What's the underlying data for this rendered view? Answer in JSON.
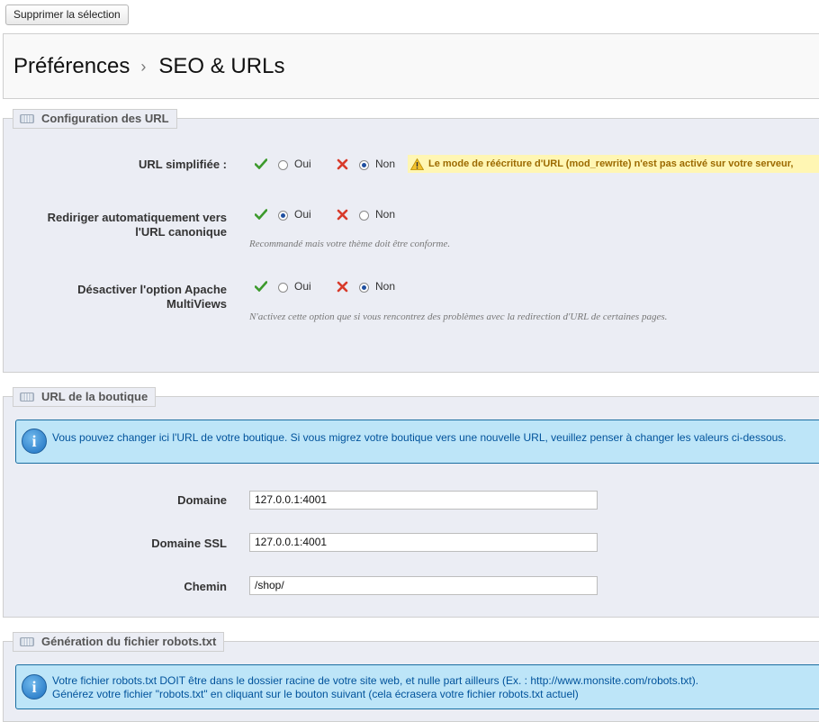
{
  "toolbar": {
    "delete_selection": "Supprimer la sélection"
  },
  "breadcrumb": {
    "parent": "Préférences",
    "separator": "›",
    "current": "SEO & URLs"
  },
  "sections": {
    "url_config": {
      "title": "Configuration des URL",
      "friendly_url": {
        "label": "URL simplifiée :",
        "yes": "Oui",
        "no": "Non",
        "selected": "no",
        "warning": "Le mode de réécriture d'URL (mod_rewrite) n'est pas activé sur votre serveur,"
      },
      "canonical_redirect": {
        "label": "Rediriger automatiquement vers l'URL canonique",
        "yes": "Oui",
        "no": "Non",
        "selected": "yes",
        "hint": "Recommandé mais votre thème doit être conforme."
      },
      "multiviews": {
        "label": "Désactiver l'option Apache MultiViews",
        "yes": "Oui",
        "no": "Non",
        "selected": "no",
        "hint": "N'activez cette option que si vous rencontrez des problèmes avec la redirection d'URL de certaines pages."
      }
    },
    "shop_url": {
      "title": "URL de la boutique",
      "info": "Vous pouvez changer ici l'URL de votre boutique. Si vous migrez votre boutique vers une nouvelle URL, veuillez penser à changer les valeurs ci-dessous.",
      "domain_label": "Domaine",
      "domain_value": "127.0.0.1:4001",
      "domain_ssl_label": "Domaine SSL",
      "domain_ssl_value": "127.0.0.1:4001",
      "path_label": "Chemin",
      "path_value": "/shop/"
    },
    "robots": {
      "title": "Génération du fichier robots.txt",
      "info_line1": "Votre fichier robots.txt DOIT être dans le dossier racine de votre site web, et nulle part ailleurs (Ex. : http://www.monsite.com/robots.txt).",
      "info_line2": "Générez votre fichier \"robots.txt\" en cliquant sur le bouton suivant (cela écrasera votre fichier robots.txt actuel)"
    }
  },
  "colors": {
    "accent_blue": "#00529b",
    "info_bg": "#bde5f8",
    "warning_bg": "#fff6b3",
    "panel_bg": "#ebedf4"
  },
  "icons": [
    "check-icon",
    "cross-icon",
    "warning-icon",
    "info-icon",
    "keyboard-icon"
  ]
}
